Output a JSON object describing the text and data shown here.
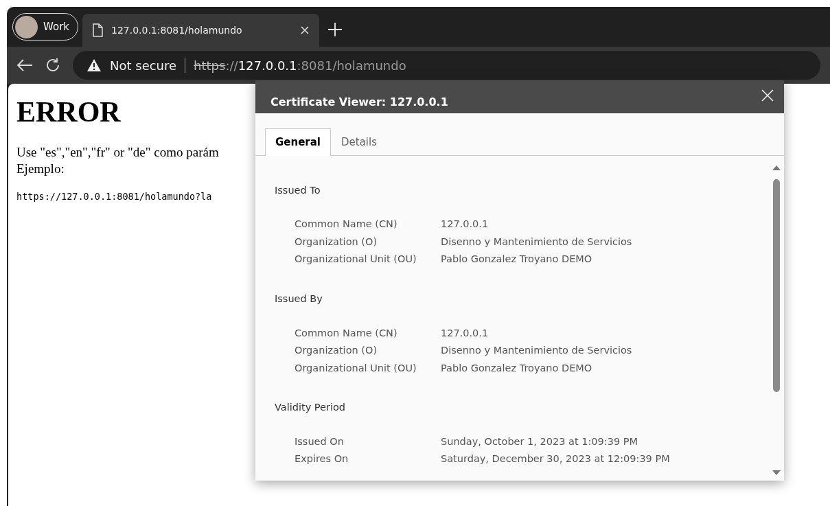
{
  "browser": {
    "profile": {
      "label": "Work"
    },
    "tabs": [
      {
        "title": "127.0.0.1:8081/holamundo",
        "selected": true
      }
    ],
    "address_bar": {
      "security": "Not secure",
      "url": {
        "scheme": "https",
        "separator": "://",
        "host": "127.0.0.1",
        "path": ":8081/holamundo"
      }
    }
  },
  "page": {
    "heading": "ERROR",
    "lines": [
      "Use \"es\",\"en\",\"fr\" or \"de\" como parám",
      "Ejemplo:"
    ],
    "example": "https://127.0.0.1:8081/holamundo?la"
  },
  "dialog": {
    "title": "Certificate Viewer: 127.0.0.1",
    "tabs": [
      {
        "label": "General",
        "selected": true
      },
      {
        "label": "Details",
        "selected": false
      }
    ],
    "sections": [
      {
        "title": "Issued To",
        "rows": [
          {
            "label": "Common Name (CN)",
            "value": "127.0.0.1"
          },
          {
            "label": "Organization (O)",
            "value": "Disenno y Mantenimiento de Servicios"
          },
          {
            "label": "Organizational Unit (OU)",
            "value": "Pablo Gonzalez Troyano DEMO"
          }
        ]
      },
      {
        "title": "Issued By",
        "rows": [
          {
            "label": "Common Name (CN)",
            "value": "127.0.0.1"
          },
          {
            "label": "Organization (O)",
            "value": "Disenno y Mantenimiento de Servicios"
          },
          {
            "label": "Organizational Unit (OU)",
            "value": "Pablo Gonzalez Troyano DEMO"
          }
        ]
      },
      {
        "title": "Validity Period",
        "rows": [
          {
            "label": "Issued On",
            "value": "Sunday, October 1, 2023 at 1:09:39 PM"
          },
          {
            "label": "Expires On",
            "value": "Saturday, December 30, 2023 at 12:09:39 PM"
          }
        ]
      }
    ]
  }
}
